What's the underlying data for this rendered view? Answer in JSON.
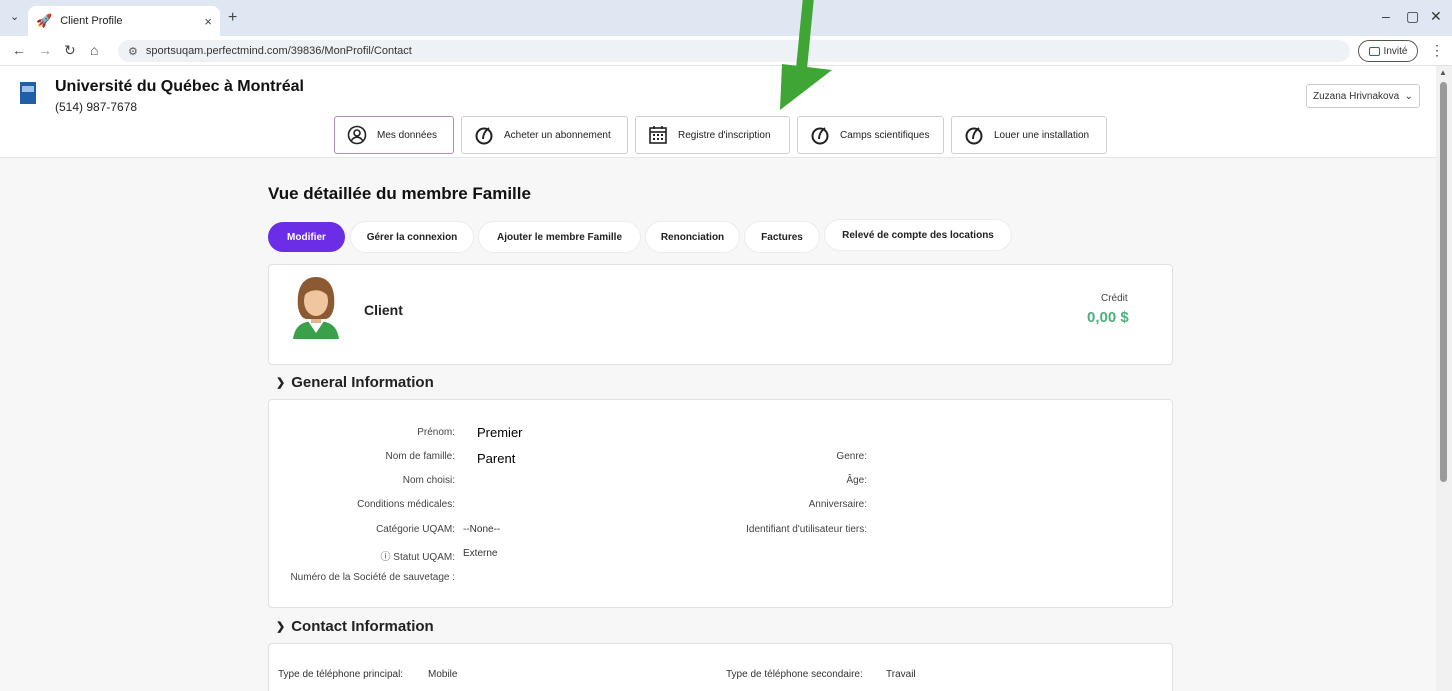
{
  "browser": {
    "tab_title": "Client Profile",
    "url": "sportsuqam.perfectmind.com/39836/MonProfil/Contact",
    "profile_label": "Invité"
  },
  "org": {
    "name": "Université du Québec à Montréal",
    "phone": "(514) 987-7678"
  },
  "user_menu": {
    "name": "Zuzana Hrivnakova"
  },
  "nav": [
    {
      "label": "Mes données",
      "icon": "user-circle-icon",
      "active": true
    },
    {
      "label": "Acheter un abonnement",
      "icon": "leaf-icon"
    },
    {
      "label": "Registre d'inscription",
      "icon": "calendar-icon"
    },
    {
      "label": "Camps scientifiques",
      "icon": "leaf-icon"
    },
    {
      "label": "Louer une installation",
      "icon": "leaf-icon"
    }
  ],
  "page": {
    "title": "Vue détaillée du membre Famille"
  },
  "actions": [
    "Modifier",
    "Gérer la connexion",
    "Ajouter le membre Famille",
    "Renonciation",
    "Factures",
    "Relevé de compte des locations"
  ],
  "profile": {
    "name": "Client",
    "credit_label": "Crédit",
    "credit_value": "0,00 $"
  },
  "general": {
    "heading": "General Information",
    "left_fields": [
      {
        "label": "Prénom:",
        "value": "Premier"
      },
      {
        "label": "Nom de famille:",
        "value": "Parent"
      },
      {
        "label": "Nom choisi:",
        "value": ""
      },
      {
        "label": "Conditions médicales:",
        "value": ""
      },
      {
        "label": "Catégorie UQAM:",
        "value": "--None--"
      },
      {
        "label": "ⓘ Statut UQAM:",
        "value": "Externe"
      },
      {
        "label": "Numéro de la Société de sauvetage :",
        "value": ""
      }
    ],
    "right_fields": [
      {
        "label": "Genre:",
        "value": ""
      },
      {
        "label": "Âge:",
        "value": ""
      },
      {
        "label": "Anniversaire:",
        "value": ""
      },
      {
        "label": "Identifiant d'utilisateur tiers:",
        "value": ""
      }
    ]
  },
  "contact": {
    "heading": "Contact Information",
    "primary_phone_label": "Type de téléphone principal:",
    "primary_phone_value": "Mobile",
    "secondary_phone_label": "Type de téléphone secondaire:",
    "secondary_phone_value": "Travail"
  },
  "colors": {
    "primary": "#6b2ee6",
    "credit": "#4caf7d",
    "arrow": "#3fa535"
  }
}
